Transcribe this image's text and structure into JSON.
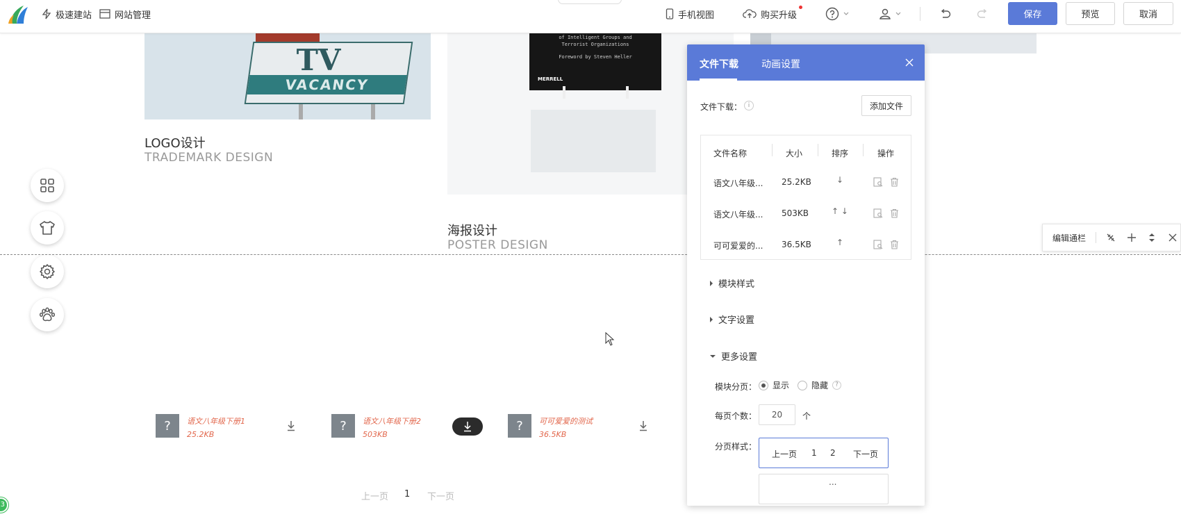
{
  "topbar": {
    "quick_build": "极速建站",
    "site_manage": "网站管理",
    "mobile_view": "手机视图",
    "buy_upgrade": "购买升级",
    "save": "保存",
    "preview": "预览",
    "cancel": "取消"
  },
  "canvas": {
    "logo_title": "LOGO设计",
    "logo_subtitle": "TRADEMARK DESIGN",
    "poster_title": "海报设计",
    "poster_subtitle": "POSTER DESIGN",
    "book_text_1": "of Intelligent Groups and",
    "book_text_2": "Terrorist Organizations",
    "book_foreword": "Foreword by Steven Heller",
    "book_publisher": "MERRELL",
    "sign_letters": "TV",
    "sign_vacancy": "VACANCY",
    "downloads": [
      {
        "name": "语文八年级下册1",
        "size": "25.2KB"
      },
      {
        "name": "语文八年级下册2",
        "size": "503KB"
      },
      {
        "name": "可可爱爱的测试",
        "size": "36.5KB"
      }
    ],
    "question_mark": "?",
    "pager": {
      "prev": "上一页",
      "page": "1",
      "next": "下一页"
    },
    "corner_badge": "3"
  },
  "section_bar": {
    "edit_label": "编辑通栏"
  },
  "panel": {
    "tab_download": "文件下载",
    "tab_animation": "动画设置",
    "file_label": "文件下载：",
    "info_mark": "i",
    "add_file": "添加文件",
    "headers": {
      "name": "文件名称",
      "size": "大小",
      "sort": "排序",
      "action": "操作"
    },
    "files": [
      {
        "name": "语文八年级...",
        "size": "25.2KB",
        "sort": "↓"
      },
      {
        "name": "语文八年级...",
        "size": "503KB",
        "sort": "↑ ↓"
      },
      {
        "name": "可可爱爱的...",
        "size": "36.5KB",
        "sort": "↑"
      }
    ],
    "module_style": "模块样式",
    "text_settings": "文字设置",
    "more_settings": "更多设置",
    "paging_label": "模块分页：",
    "show": "显示",
    "hide": "隐藏",
    "help_mark": "?",
    "per_page_label": "每页个数：",
    "per_page_value": "20",
    "per_page_unit": "个",
    "pager_style_label": "分页样式：",
    "pager_sample": {
      "prev": "上一页",
      "p1": "1",
      "p2": "2",
      "next": "下一页"
    },
    "ellipsis": "..."
  },
  "colors": {
    "accent": "#5a7ad8",
    "download_text": "#e2674c"
  }
}
